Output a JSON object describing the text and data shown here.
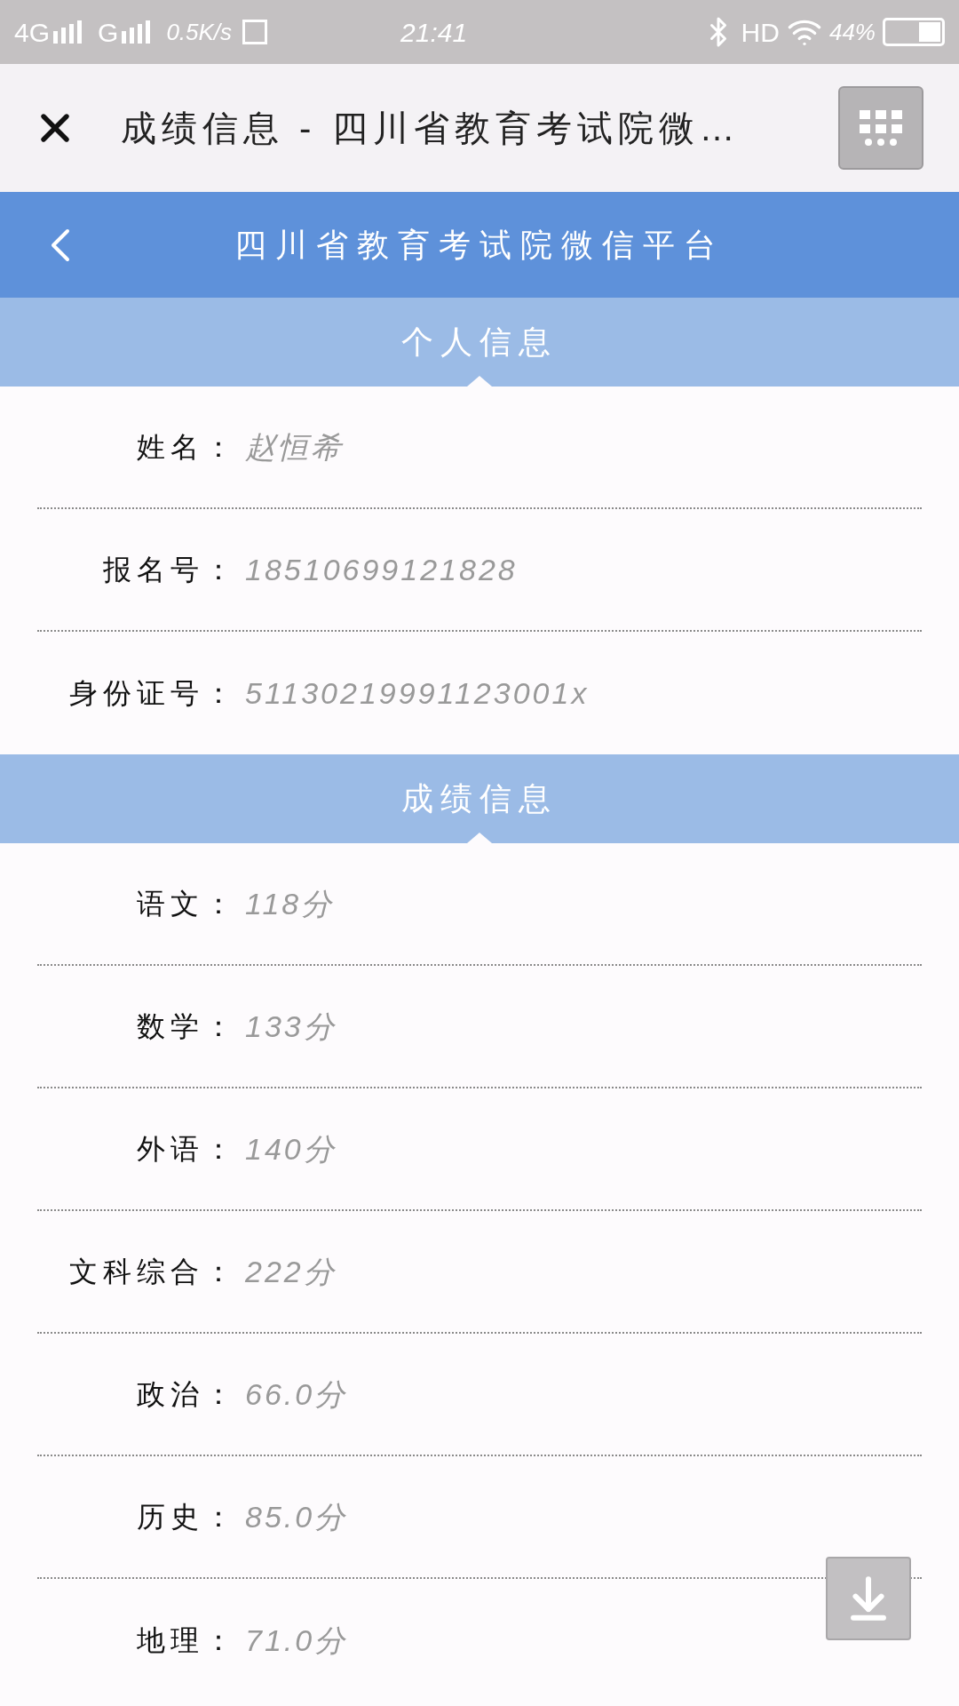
{
  "status_bar": {
    "network_1": "4G",
    "network_2": "G",
    "speed": "0.5K/s",
    "time": "21:41",
    "hd": "HD",
    "battery": "44%"
  },
  "title_bar": {
    "title": "成绩信息 - 四川省教育考试院微…"
  },
  "header": {
    "title": "四川省教育考试院微信平台"
  },
  "sections": [
    {
      "title": "个人信息",
      "rows": [
        {
          "label": "姓名：",
          "value": "赵恒希"
        },
        {
          "label": "报名号：",
          "value": "18510699121828"
        },
        {
          "label": "身份证号：",
          "value": "51130219991123001x"
        }
      ]
    },
    {
      "title": "成绩信息",
      "rows": [
        {
          "label": "语文：",
          "value": "118分"
        },
        {
          "label": "数学：",
          "value": "133分"
        },
        {
          "label": "外语：",
          "value": "140分"
        },
        {
          "label": "文科综合：",
          "value": "222分"
        },
        {
          "label": "政治：",
          "value": "66.0分"
        },
        {
          "label": "历史：",
          "value": "85.0分"
        },
        {
          "label": "地理：",
          "value": "71.0分"
        }
      ]
    }
  ]
}
